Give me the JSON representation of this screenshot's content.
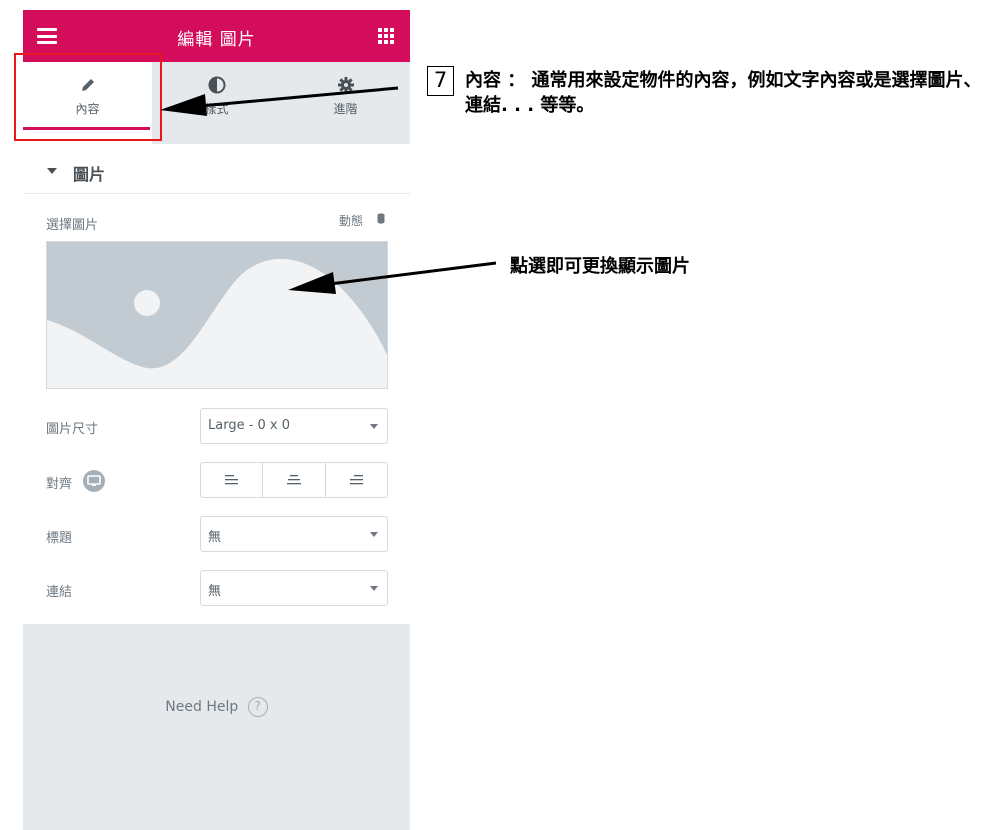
{
  "header": {
    "title": "編輯 圖片"
  },
  "tabs": [
    {
      "label": "內容",
      "icon": "pencil-icon"
    },
    {
      "label": "樣式",
      "icon": "half-circle-icon"
    },
    {
      "label": "進階",
      "icon": "gear-icon"
    }
  ],
  "section": {
    "title": "圖片"
  },
  "image_control": {
    "label": "選擇圖片",
    "dynamic": "動態"
  },
  "size_control": {
    "label": "圖片尺寸",
    "value": "Large - 0 x 0"
  },
  "align_control": {
    "label": "對齊"
  },
  "caption_control": {
    "label": "標題",
    "value": "無"
  },
  "link_control": {
    "label": "連結",
    "value": "無"
  },
  "help": {
    "label": "Need Help",
    "icon": "?"
  },
  "annotations": {
    "note1_number": "7",
    "note1_text": "內容 ： 通常用來設定物件的內容，例如文字內容或是選擇圖片、連結. . . 等等。",
    "note2_text": "點選即可更換顯示圖片"
  },
  "colors": {
    "brand": "#d30c5c",
    "annotation_red": "#e8161e",
    "panel_gray": "#e6e9ec"
  }
}
